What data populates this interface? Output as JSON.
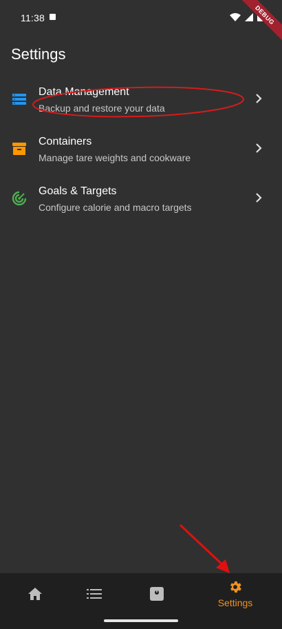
{
  "status_bar": {
    "time": "11:38"
  },
  "debug_banner": {
    "label": "DEBUG"
  },
  "page": {
    "title": "Settings"
  },
  "settings_items": [
    {
      "title": "Data Management",
      "subtitle": "Backup and restore your data",
      "icon": "storage-icon",
      "icon_color": "#2196f3"
    },
    {
      "title": "Containers",
      "subtitle": "Manage tare weights and cookware",
      "icon": "inventory-box-icon",
      "icon_color": "#ff9800"
    },
    {
      "title": "Goals & Targets",
      "subtitle": "Configure calorie and macro targets",
      "icon": "target-icon",
      "icon_color": "#4caf50"
    }
  ],
  "bottom_nav": {
    "items": [
      {
        "icon": "home-icon",
        "label": ""
      },
      {
        "icon": "list-icon",
        "label": ""
      },
      {
        "icon": "scale-icon",
        "label": ""
      },
      {
        "icon": "gear-icon",
        "label": "Settings",
        "selected": true
      }
    ],
    "selected_color": "#f29121",
    "unselected_color": "#bdbdbd"
  },
  "colors": {
    "background": "#303030",
    "nav_background": "#1f1f1f",
    "annotation": "#d81b1b"
  }
}
